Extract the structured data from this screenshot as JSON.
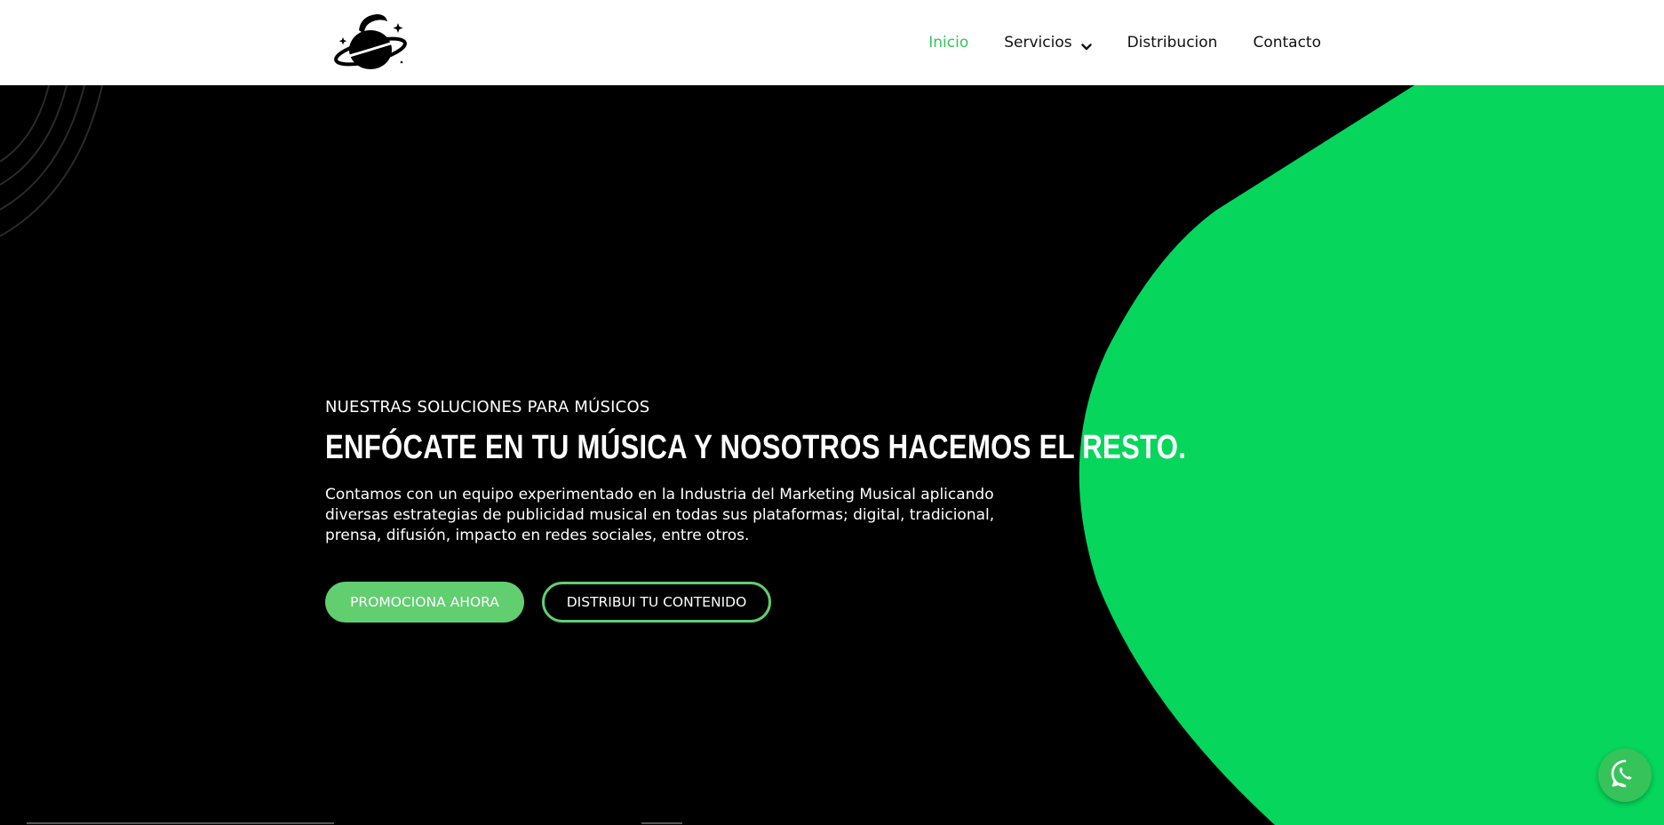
{
  "nav": {
    "items": [
      {
        "label": "Inicio",
        "active": true
      },
      {
        "label": "Servicios",
        "dropdown": true
      },
      {
        "label": "Distribucion"
      },
      {
        "label": "Contacto"
      }
    ]
  },
  "hero": {
    "eyebrow": "NUESTRAS SOLUCIONES PARA MÚSICOS",
    "headline": "ENFÓCATE EN TU MÚSICA Y NOSOTROS HACEMOS EL RESTO.",
    "description": "Contamos con un equipo experimentado en la Industria del Marketing Musical aplicando diversas estrategias de publicidad musical en todas sus plataformas; digital, tradicional, prensa, difusión, impacto en redes sociales, entre otros.",
    "primary_button": "PROMOCIONA AHORA",
    "secondary_button": "DISTRIBUI TU CONTENIDO"
  },
  "colors": {
    "accent": "#61ce70",
    "active_nav": "#36c45a",
    "blob": "#06d65c",
    "background": "#000000",
    "header_bg": "#ffffff"
  },
  "icons": {
    "logo": "planet-logo",
    "dropdown": "chevron-down-icon",
    "whatsapp": "whatsapp-icon"
  }
}
